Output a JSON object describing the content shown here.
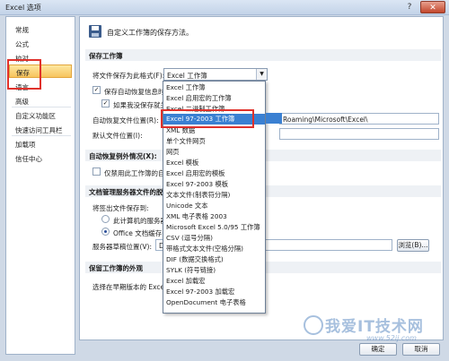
{
  "window": {
    "title": "Excel 选项",
    "help_label": "?",
    "close_label": "✕"
  },
  "sidebar": {
    "items": [
      {
        "label": "常规"
      },
      {
        "label": "公式"
      },
      {
        "label": "校对"
      },
      {
        "label": "保存"
      },
      {
        "label": "语言"
      },
      {
        "label": "高级"
      },
      {
        "label": "自定义功能区"
      },
      {
        "label": "快速访问工具栏"
      },
      {
        "label": "加载项"
      },
      {
        "label": "信任中心"
      }
    ]
  },
  "main": {
    "intro": "自定义工作簿的保存方法。",
    "section_save": "保存工作簿",
    "format_label": "将文件保存为此格式(F):",
    "format_value": "Excel 工作簿",
    "autorecover_label": "保存自动恢复信息时间",
    "keep_last_label": "如果我没保存就关",
    "autorecover_location_label": "自动恢复文件位置(R):",
    "autorecover_path": "Roaming\\Microsoft\\Excel\\",
    "default_location_label": "默认文件位置(I):",
    "section_exceptions": "自动恢复例外情况(X):",
    "disable_label": "仅禁用此工作簿的自动",
    "section_server": "文档管理服务器文件的脱机",
    "checkout_label": "将签出文件保存到:",
    "server_drafts_label": "此计算机的服务器",
    "office_cache_label": "Office 文档缓存(O",
    "server_drafts_location_label": "服务器草稿位置(V):",
    "server_path": "D:\\",
    "browse_label": "浏览(B)...",
    "section_appearance": "保留工作簿的外观",
    "colors_label": "选择在早期版本的 Excel"
  },
  "dropdown": {
    "options": [
      "Excel 工作簿",
      "Excel 启用宏的工作簿",
      "Excel 二进制工作簿",
      "Excel 97-2003 工作簿",
      "XML 数据",
      "单个文件网页",
      "网页",
      "Excel 模板",
      "Excel 启用宏的模板",
      "Excel 97-2003 模板",
      "文本文件(制表符分隔)",
      "Unicode 文本",
      "XML 电子表格 2003",
      "Microsoft Excel 5.0/95 工作簿",
      "CSV (逗号分隔)",
      "带格式文本文件(空格分隔)",
      "DIF (数据交换格式)",
      "SYLK (符号链接)",
      "Excel 加载宏",
      "Excel 97-2003 加载宏",
      "OpenDocument 电子表格"
    ],
    "selected_index": 3
  },
  "footer": {
    "ok_label": "确定",
    "cancel_label": "取消"
  },
  "watermark": {
    "text": "我爱IT技术网",
    "site": "www.52ij.com"
  },
  "colors": {
    "accent_highlight": "#3a80d2",
    "selected_nav": "#f7c45e",
    "annotation_red": "#e0312b"
  }
}
